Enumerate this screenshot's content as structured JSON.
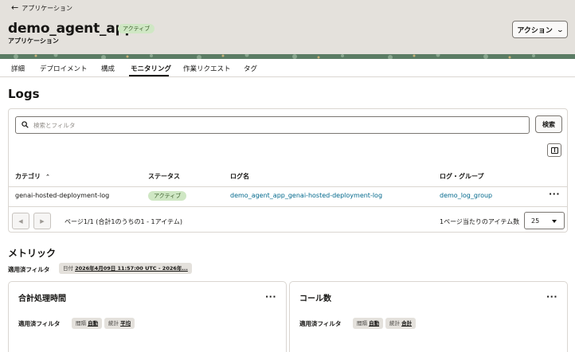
{
  "header": {
    "back_label": "アプリケーション",
    "title": "demo_agent_app",
    "status_badge": "アクティブ",
    "subtitle": "アプリケーション",
    "action_label": "アクション"
  },
  "tabs": [
    {
      "label": "詳細"
    },
    {
      "label": "デプロイメント"
    },
    {
      "label": "構成"
    },
    {
      "label": "モニタリング",
      "active": true
    },
    {
      "label": "作業リクエスト"
    },
    {
      "label": "タグ"
    }
  ],
  "logs": {
    "title": "Logs",
    "search_placeholder": "検索とフィルタ",
    "search_button": "検索",
    "columns": [
      "カテゴリ",
      "ステータス",
      "ログ名",
      "ログ・グループ"
    ],
    "rows": [
      {
        "category": "genai-hosted-deployment-log",
        "status": "アクティブ",
        "log_name": "demo_agent_app_genai-hosted-deployment-log",
        "log_group": "demo_log_group"
      }
    ],
    "pager_text": "ページ1/1 (合計1のうちの1 - 1アイテム)",
    "per_page_label": "1ページ当たりのアイテム数",
    "per_page_value": "25"
  },
  "metrics": {
    "title": "メトリック",
    "applied_filter_label": "適用済フィルタ",
    "date_filter_key": "日付",
    "date_filter_value": "2026年4月09日 11:57:00 UTC - 2026年...",
    "cards": [
      {
        "title": "合計処理時間",
        "filter_label": "適用済フィルタ",
        "chips": [
          {
            "key": "間隔",
            "value": "自動"
          },
          {
            "key": "統計",
            "value": "平均"
          }
        ]
      },
      {
        "title": "コール数",
        "filter_label": "適用済フィルタ",
        "chips": [
          {
            "key": "間隔",
            "value": "自動"
          },
          {
            "key": "統計",
            "value": "合計"
          }
        ]
      }
    ]
  },
  "colors": {
    "header_bg": "#e4e1dc",
    "active_pill": "#cfe7c4",
    "link": "#00688c",
    "band": "#5b7c64"
  }
}
